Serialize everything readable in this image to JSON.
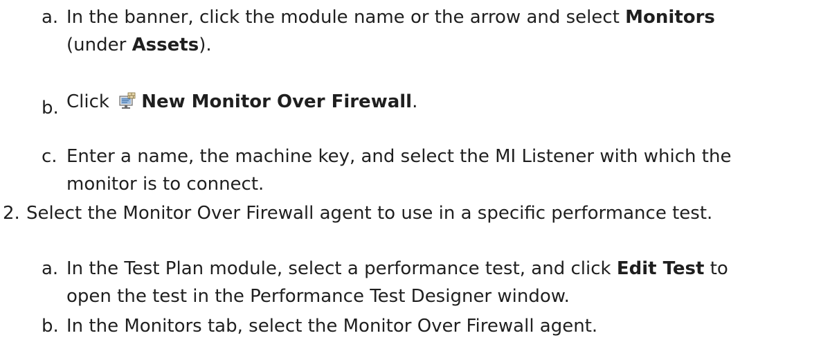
{
  "steps": {
    "a1": {
      "marker": "a.",
      "line1_pre": "In the banner, click the module name or the arrow and select ",
      "line1_bold": "Monitors",
      "line2_pre": "(under ",
      "line2_bold": "Assets",
      "line2_post": ")."
    },
    "b1": {
      "marker": "b.",
      "pre": "Click ",
      "icon": "monitor-over-firewall-icon",
      "bold": "New Monitor Over Firewall",
      "post": "."
    },
    "c1": {
      "marker": "c.",
      "line1": "Enter a name, the machine key, and select the MI Listener with which the",
      "line2": "monitor is to connect."
    },
    "s2": {
      "marker": "2.",
      "text": "Select the Monitor Over Firewall agent to use in a specific performance test."
    },
    "a2": {
      "marker": "a.",
      "line1_pre": "In the Test Plan module, select a performance test, and click ",
      "line1_bold": "Edit Test",
      "line1_post": " to",
      "line2": "open the test in the Performance Test Designer window."
    },
    "b2": {
      "marker": "b.",
      "text": "In the Monitors tab, select the Monitor Over Firewall agent."
    }
  }
}
